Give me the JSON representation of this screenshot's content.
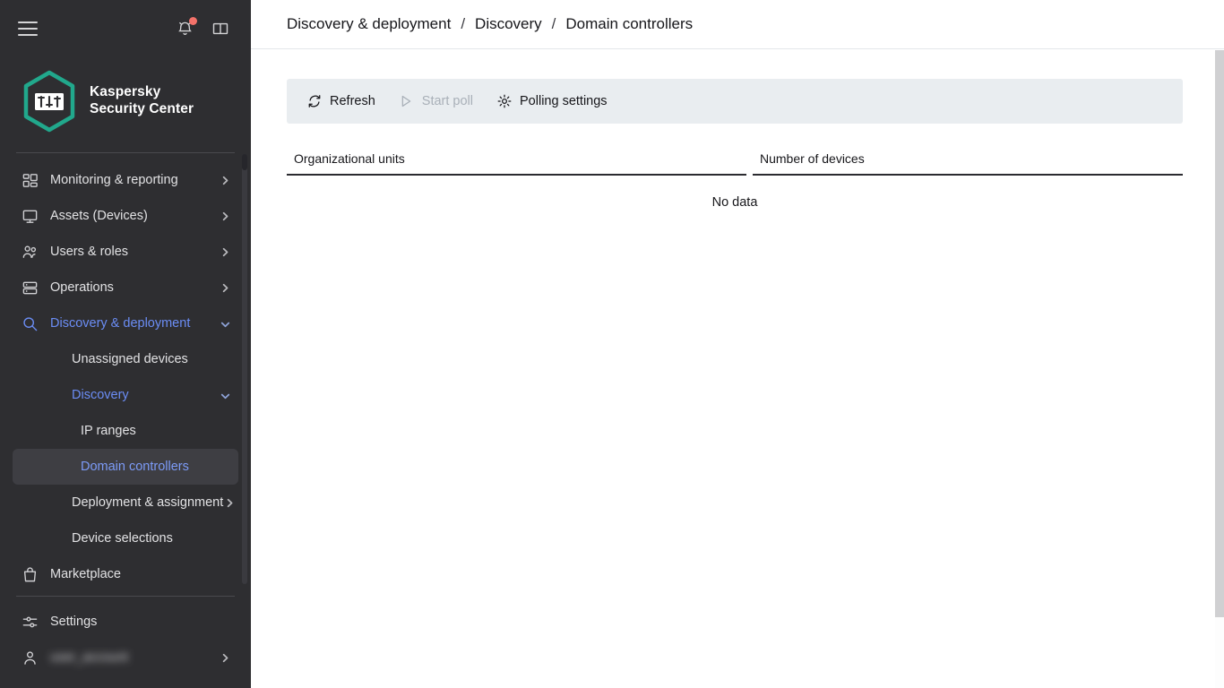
{
  "sidebar": {
    "topbar": {
      "menu_icon": "hamburger-icon",
      "notifications_icon": "bell-icon",
      "has_notification_badge": true,
      "badge_color": "#f4726a",
      "help_icon": "book-icon"
    },
    "logo": {
      "line1": "Kaspersky",
      "line2": "Security Center",
      "accent_color": "#21a88c"
    },
    "nav": [
      {
        "label": "Monitoring & reporting",
        "icon": "dashboard-grid-icon",
        "chevron": "chevron-right",
        "level": 0,
        "state": "default"
      },
      {
        "label": "Assets (Devices)",
        "icon": "monitor-icon",
        "chevron": "chevron-right",
        "level": 0,
        "state": "default"
      },
      {
        "label": "Users & roles",
        "icon": "users-icon",
        "chevron": "chevron-right",
        "level": 0,
        "state": "default"
      },
      {
        "label": "Operations",
        "icon": "server-stack-icon",
        "chevron": "chevron-right",
        "level": 0,
        "state": "default"
      },
      {
        "label": "Discovery & deployment",
        "icon": "search-icon",
        "chevron": "chevron-down",
        "level": 0,
        "state": "accent"
      },
      {
        "label": "Unassigned devices",
        "icon": "",
        "chevron": "",
        "level": 1,
        "state": "default"
      },
      {
        "label": "Discovery",
        "icon": "",
        "chevron": "chevron-down",
        "level": 1,
        "state": "accent"
      },
      {
        "label": "IP ranges",
        "icon": "",
        "chevron": "",
        "level": 2,
        "state": "default"
      },
      {
        "label": "Domain controllers",
        "icon": "",
        "chevron": "",
        "level": 2,
        "state": "active"
      },
      {
        "label": "Deployment & assignment",
        "icon": "",
        "chevron": "chevron-right",
        "level": 1,
        "state": "default"
      },
      {
        "label": "Device selections",
        "icon": "",
        "chevron": "",
        "level": 1,
        "state": "default"
      },
      {
        "label": "Marketplace",
        "icon": "shopping-bag-icon",
        "chevron": "",
        "level": 0,
        "state": "default"
      }
    ],
    "bottom": [
      {
        "label": "Settings",
        "icon": "sliders-icon",
        "chevron": "",
        "blurred": false
      },
      {
        "label": "user_account",
        "icon": "person-icon",
        "chevron": "chevron-right",
        "blurred": true
      }
    ]
  },
  "breadcrumb": {
    "items": [
      "Discovery & deployment",
      "Discovery",
      "Domain controllers"
    ],
    "separator": "/"
  },
  "toolbar": {
    "buttons": [
      {
        "label": "Refresh",
        "icon": "refresh-icon",
        "disabled": false
      },
      {
        "label": "Start poll",
        "icon": "play-icon",
        "disabled": true
      },
      {
        "label": "Polling settings",
        "icon": "gear-icon",
        "disabled": false
      }
    ]
  },
  "table": {
    "columns": [
      "Organizational units",
      "Number of devices"
    ],
    "rows": [],
    "empty_message": "No data"
  }
}
